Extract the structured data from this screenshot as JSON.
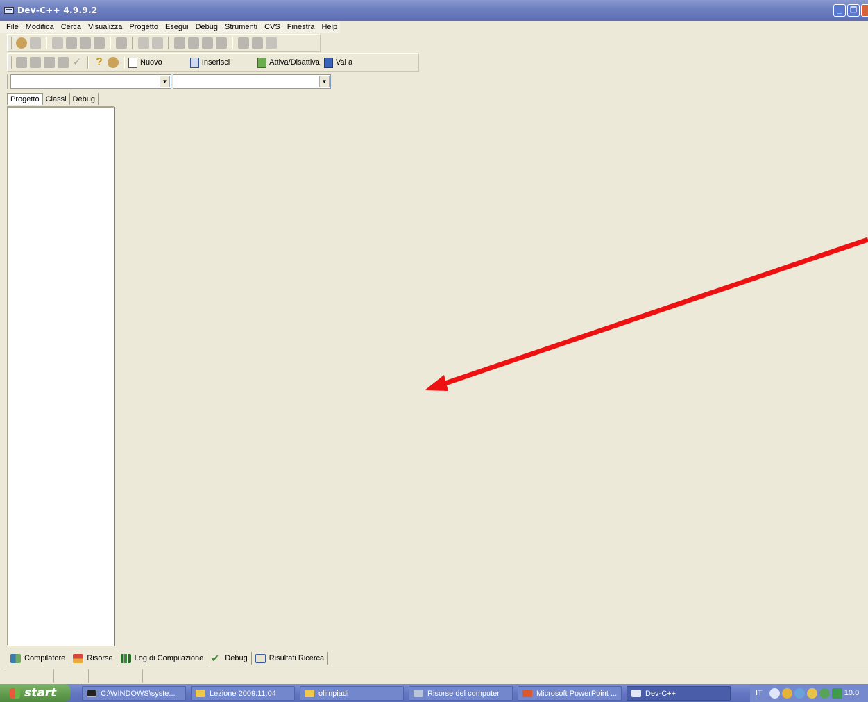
{
  "window": {
    "title": "Dev-C++ 4.9.9.2"
  },
  "menu": [
    "File",
    "Modifica",
    "Cerca",
    "Visualizza",
    "Progetto",
    "Esegui",
    "Debug",
    "Strumenti",
    "CVS",
    "Finestra",
    "Help"
  ],
  "toolbar2": {
    "nuovo": "Nuovo",
    "inserisci": "Inserisci",
    "attiva": "Attiva/Disattiva",
    "vai": "Vai a"
  },
  "left_tabs": [
    "Progetto",
    "Classi",
    "Debug"
  ],
  "bottom_tabs": [
    "Compilatore",
    "Risorse",
    "Log di Compilazione",
    "Debug",
    "Risultati Ricerca"
  ],
  "taskbar": {
    "start": "start",
    "tasks": [
      {
        "label": "C:\\WINDOWS\\syste...",
        "icon": "console-icon"
      },
      {
        "label": "Lezione 2009.11.04",
        "icon": "folder-icon"
      },
      {
        "label": "olimpiadi",
        "icon": "folder-icon"
      },
      {
        "label": "Risorse del computer",
        "icon": "computer-icon"
      },
      {
        "label": "Microsoft PowerPoint ...",
        "icon": "powerpoint-icon"
      },
      {
        "label": "Dev-C++",
        "icon": "devcpp-icon"
      }
    ],
    "language": "IT",
    "clock": "10.0"
  },
  "annotation": {
    "color": "#ee1111"
  }
}
